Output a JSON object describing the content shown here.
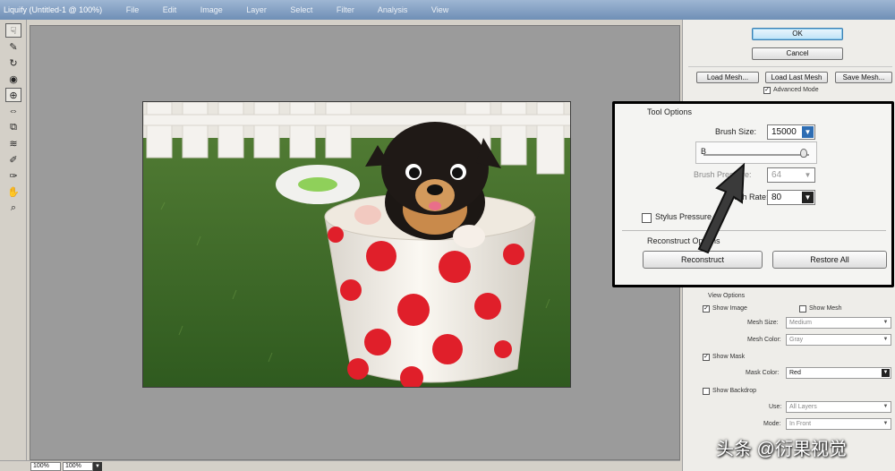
{
  "window": {
    "title": "Liquify (Untitled-1 @ 100%)",
    "menu_ghosts": [
      "File",
      "Edit",
      "Image",
      "Layer",
      "Select",
      "Filter",
      "Analysis",
      "View"
    ]
  },
  "tools": [
    {
      "name": "forward-warp-tool",
      "glyph": "☟"
    },
    {
      "name": "reconstruct-tool",
      "glyph": "✎"
    },
    {
      "name": "twirl-tool",
      "glyph": "↻"
    },
    {
      "name": "pucker-tool",
      "glyph": "◉"
    },
    {
      "name": "bloat-tool",
      "glyph": "⊕"
    },
    {
      "name": "push-left-tool",
      "glyph": "⇔"
    },
    {
      "name": "mirror-tool",
      "glyph": "⧉"
    },
    {
      "name": "turbulence-tool",
      "glyph": "≋"
    },
    {
      "name": "freeze-mask-tool",
      "glyph": "✐"
    },
    {
      "name": "thaw-mask-tool",
      "glyph": "✑"
    },
    {
      "name": "hand-tool",
      "glyph": "✋"
    },
    {
      "name": "zoom-tool",
      "glyph": "⌕"
    }
  ],
  "status": {
    "zoom": "100%",
    "zoom2": "100%"
  },
  "panel": {
    "ok": "OK",
    "cancel": "Cancel",
    "load_mesh": "Load Mesh...",
    "load_last_mesh": "Load Last Mesh",
    "save_mesh": "Save Mesh...",
    "advanced_mode": "Advanced Mode",
    "view_options": "View Options",
    "show_image": "Show Image",
    "show_mesh": "Show Mesh",
    "mesh_size_label": "Mesh Size:",
    "mesh_size_value": "Medium",
    "mesh_color_label": "Mesh Color:",
    "mesh_color_value": "Gray",
    "show_mask": "Show Mask",
    "mask_color_label": "Mask Color:",
    "mask_color_value": "Red",
    "show_backdrop": "Show Backdrop",
    "use_label": "Use:",
    "use_value": "All Layers",
    "mode_label": "Mode:",
    "mode_value": "In Front"
  },
  "callout": {
    "legend": "Tool Options",
    "brush_size_label": "Brush Size:",
    "brush_size_value": "15000",
    "brush_density_label": "B",
    "brush_pressure_label": "Brush Pressure:",
    "brush_pressure_value": "64",
    "brush_rate_label": "Brush Rate:",
    "brush_rate_value": "80",
    "stylus_pressure": "Stylus Pressure",
    "reconstruct_options": "Reconstruct Options",
    "reconstruct": "Reconstruct",
    "restore_all": "Restore All"
  },
  "watermark": "头条 @衍果视觉",
  "colors": {
    "accent": "#3c7fb1",
    "canvas_bg": "#9b9b9b",
    "panel_bg": "#eeede9",
    "callout_border": "#000000"
  }
}
